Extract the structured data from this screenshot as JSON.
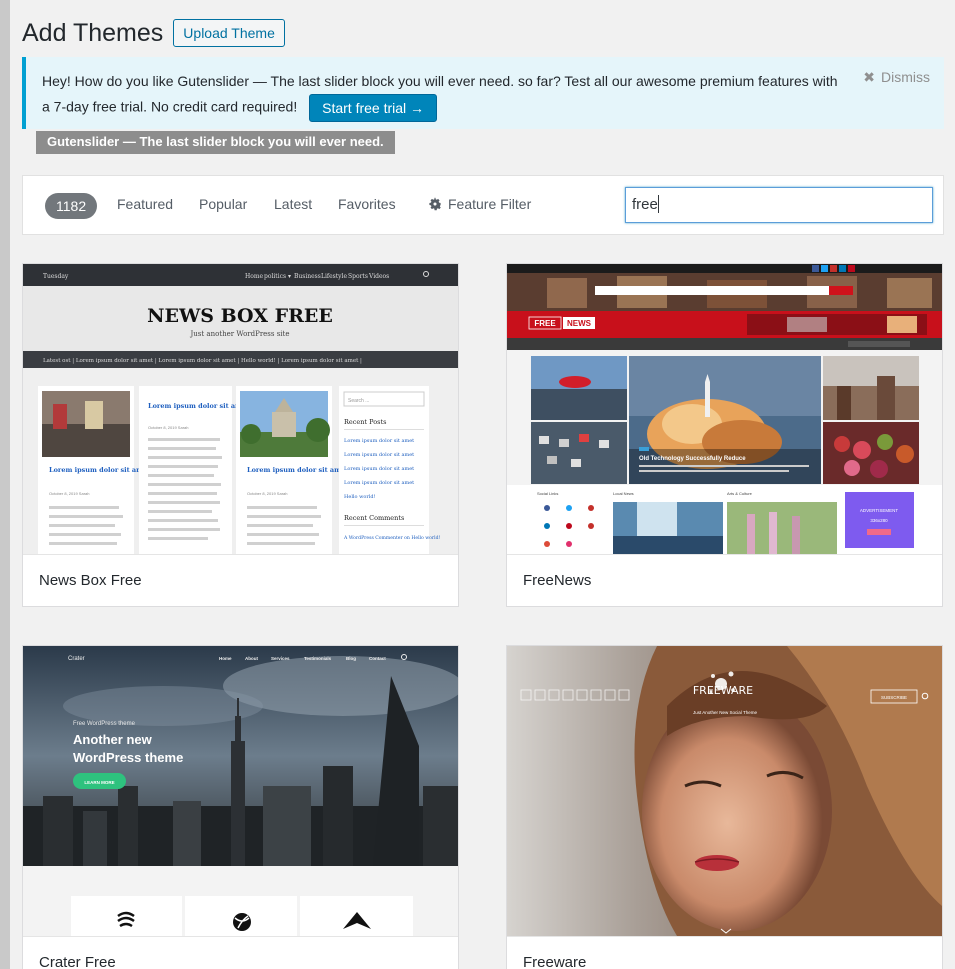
{
  "page": {
    "title": "Add Themes",
    "upload_label": "Upload Theme"
  },
  "notice": {
    "text_1": "Hey! How do you like ",
    "product": "Gutenslider — The last slider block you will ever need.",
    "text_2": " so far? Test all our awesome premium features with a 7-day free trial. No credit card required!",
    "trial_label": "Start free trial",
    "dismiss_label": "Dismiss"
  },
  "tooltip": "Gutenslider — The last slider block you will ever need.",
  "filter": {
    "count": "1182",
    "tabs": [
      "Featured",
      "Popular",
      "Latest",
      "Favorites"
    ],
    "feature_filter": "Feature Filter",
    "search_value": "free"
  },
  "themes": [
    {
      "name": "News Box Free",
      "preview": {
        "nav_day": "Tuesday",
        "nav_links": [
          "Home",
          "politics ▾",
          "Business",
          "Lifestyle",
          "Sports",
          "Videos"
        ],
        "title": "NEWS BOX FREE",
        "tagline": "Just another WordPress site",
        "ticker": "Latest     ost  |  Lorem ipsum dolor sit amet  |  Lorem ipsum dolor sit amet  |  Hello world!  |  Lorem ipsum dolor sit amet  |",
        "post_title": "Lorem ipsum dolor sit amet",
        "post_meta": "October 8, 2019  Sarah",
        "search_ph": "Search ...",
        "recent_posts": "Recent Posts",
        "recent_items": [
          "Lorem ipsum dolor sit amet",
          "Lorem ipsum dolor sit amet",
          "Lorem ipsum dolor sit amet",
          "Lorem ipsum dolor sit amet",
          "Hello world!"
        ],
        "recent_comments": "Recent Comments",
        "comment": "A WordPress Commenter on Hello world!"
      }
    },
    {
      "name": "FreeNews",
      "preview": {
        "logo_free": "FREE",
        "logo_news": "NEWS",
        "headline": "Old Technology Successfully Reduce",
        "ad_label": "ADVERTISEMENT",
        "ad_size": "336x280",
        "section_social": "Social Links",
        "section_local": "Local News",
        "section_arts": "Arts & Culture"
      }
    },
    {
      "name": "Crater Free",
      "preview": {
        "logo": "Crater",
        "nav_links": [
          "Home",
          "About",
          "Services",
          "Testimonials",
          "Blog",
          "Contact"
        ],
        "kicker": "Free WordPress theme",
        "headline_1": "Another new",
        "headline_2": "WordPress theme",
        "cta": "LEARN MORE"
      }
    },
    {
      "name": "Freeware",
      "preview": {
        "logo": "FREEWARE",
        "tagline": "Just Another New Social Theme",
        "subscribe": "SUBSCRIBE"
      }
    }
  ]
}
